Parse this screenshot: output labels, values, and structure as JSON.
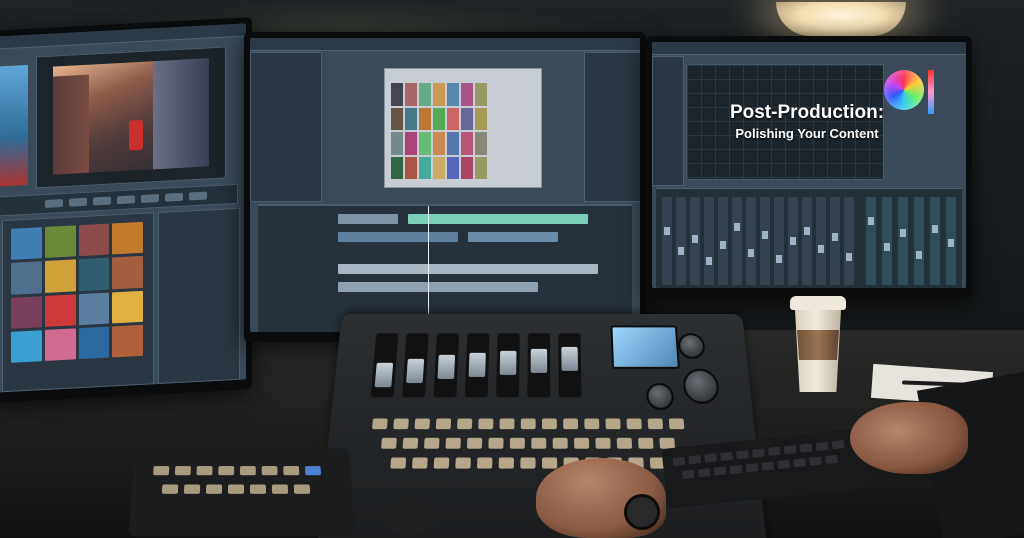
{
  "overlay": {
    "line1": "Post-Production:",
    "line2": "Polishing Your Content"
  },
  "colors": {
    "overlay_text": "#ffffff",
    "screen_bg": "#3a4a58",
    "lamp_glow": "#f3dfb2",
    "footage_accent": "#c9302c"
  },
  "icons": [
    "color-wheel-icon",
    "fader-icon",
    "jog-knob-icon"
  ]
}
